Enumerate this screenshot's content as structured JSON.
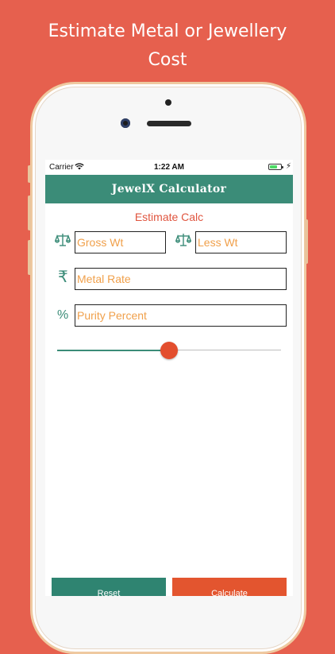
{
  "headline": {
    "line1": "Estimate Metal or Jewellery",
    "line2": "Cost"
  },
  "status_bar": {
    "carrier": "Carrier",
    "time": "1:22 AM",
    "battery_level": 0.7
  },
  "navbar": {
    "title": "JewelX  Calculator"
  },
  "form": {
    "section_title": "Estimate Calc",
    "gross_wt_placeholder": "Gross Wt",
    "less_wt_placeholder": "Less Wt",
    "metal_rate_placeholder": "Metal Rate",
    "purity_placeholder": "Purity Percent",
    "rupee_symbol": "₹",
    "percent_symbol": "%",
    "slider_value": 0.5
  },
  "actions": {
    "reset_label": "Reset",
    "calculate_label": "Calculate"
  },
  "colors": {
    "background": "#E6604E",
    "primary": "#3B8C78",
    "accent": "#E3552F",
    "placeholder": "#F0A04B"
  },
  "icons": {
    "weight": "balance-scale-icon",
    "rate": "rupee-icon",
    "purity": "percent-icon",
    "wifi": "wifi-icon",
    "battery": "battery-icon",
    "charging": "charging-bolt-icon"
  }
}
